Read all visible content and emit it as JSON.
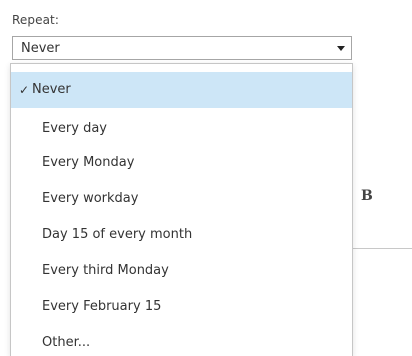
{
  "repeat": {
    "label": "Repeat:",
    "selected_value": "Never"
  },
  "dropdown": {
    "check_glyph": "✓",
    "options": [
      {
        "label": "Never",
        "selected": true
      },
      {
        "label": "Every day",
        "selected": false
      },
      {
        "label": "Every Monday",
        "selected": false
      },
      {
        "label": "Every workday",
        "selected": false
      },
      {
        "label": "Day 15 of every month",
        "selected": false
      },
      {
        "label": "Every third Monday",
        "selected": false
      },
      {
        "label": "Every February 15",
        "selected": false
      },
      {
        "label": "Other...",
        "selected": false
      }
    ]
  },
  "background": {
    "letter": "B"
  },
  "colors": {
    "selected_bg": "#cde6f7",
    "border": "#a6a6a6"
  }
}
